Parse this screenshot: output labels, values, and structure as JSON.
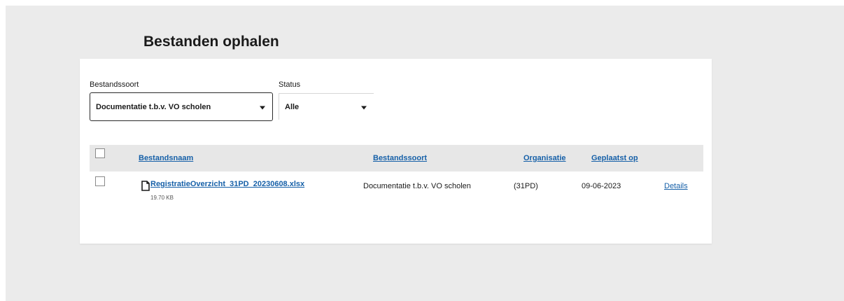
{
  "page": {
    "title": "Bestanden ophalen"
  },
  "filters": {
    "type_label": "Bestandssoort",
    "type_value": "Documentatie t.b.v. VO scholen",
    "status_label": "Status",
    "status_value": "Alle"
  },
  "table": {
    "columns": {
      "name": "Bestandsnaam",
      "type": "Bestandssoort",
      "organisation": "Organisatie",
      "placed_on": "Geplaatst op"
    },
    "rows": [
      {
        "file_name": "RegistratieOverzicht_31PD_20230608.xlsx",
        "file_size": "19.70 KB",
        "type": "Documentatie t.b.v. VO scholen",
        "organisation": "(31PD)",
        "placed_on": "09-06-2023",
        "details_label": "Details"
      }
    ]
  },
  "icons": {
    "file": "file-icon",
    "caret": "chevron-down-icon"
  },
  "colors": {
    "link": "#1660a8",
    "header_bg": "#e7e7e7",
    "page_bg": "#ebebeb"
  }
}
